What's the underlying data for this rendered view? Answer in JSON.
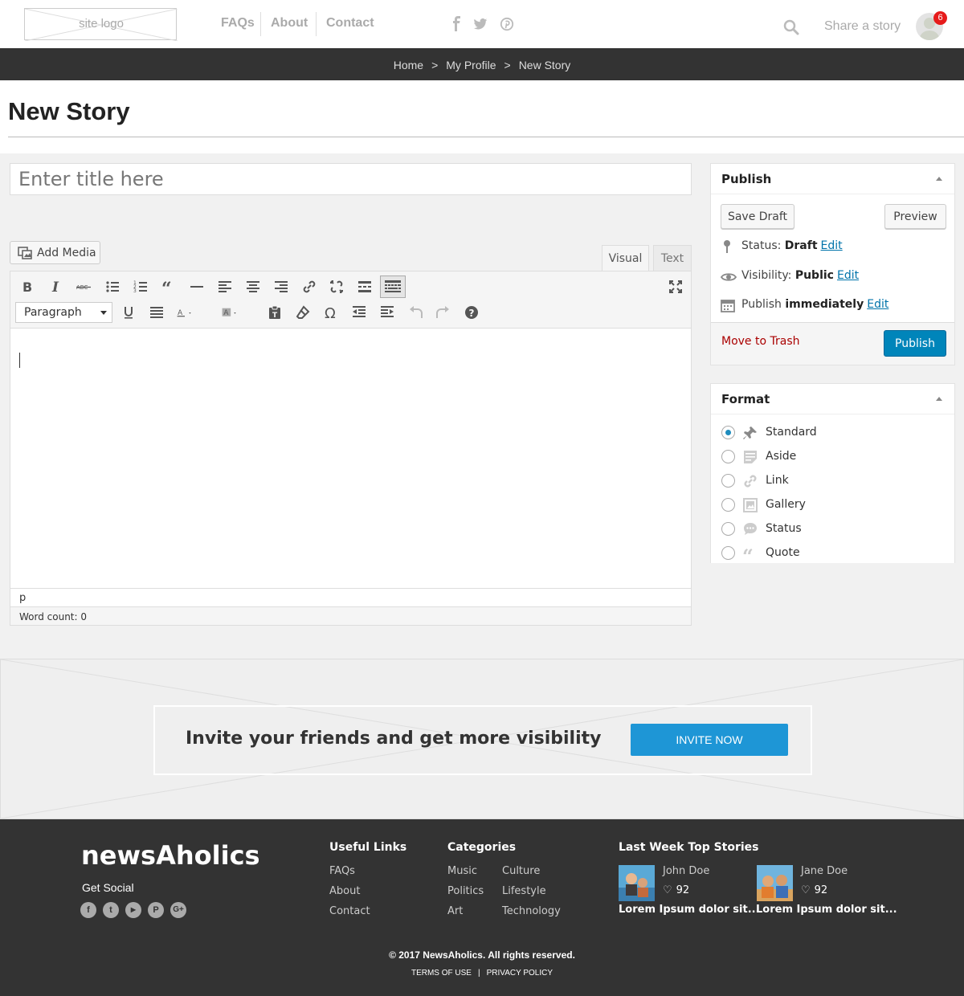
{
  "header": {
    "logo_text": "site logo",
    "nav": [
      "FAQs",
      "About",
      "Contact"
    ],
    "share_label": "Share a story",
    "notification_count": "6",
    "icons": [
      "facebook-icon",
      "twitter-icon",
      "pinterest-icon",
      "search-icon",
      "avatar"
    ]
  },
  "breadcrumb": {
    "items": [
      "Home",
      "My Profile",
      "New Story"
    ],
    "separator": ">"
  },
  "page": {
    "title": "New Story"
  },
  "editor": {
    "title_placeholder": "Enter title here",
    "add_media_label": "Add Media",
    "tabs": [
      "Visual",
      "Text"
    ],
    "active_tab": "Visual",
    "format_select": "Paragraph",
    "path": "p",
    "word_count": "Word count: 0",
    "toolbar_row1": [
      "bold",
      "italic",
      "strikethrough",
      "bulleted-list",
      "numbered-list",
      "blockquote",
      "horizontal-line",
      "align-left",
      "align-center",
      "align-right",
      "insert-link",
      "remove-link",
      "read-more",
      "toolbar-toggle",
      "fullscreen"
    ],
    "toolbar_row2": [
      "underline",
      "justify",
      "text-color",
      "background-color",
      "paste-as-text",
      "clear-formatting",
      "special-character",
      "decrease-indent",
      "increase-indent",
      "undo",
      "redo",
      "help"
    ]
  },
  "publish": {
    "title": "Publish",
    "save_draft": "Save Draft",
    "preview": "Preview",
    "status_label": "Status:",
    "status_value": "Draft",
    "visibility_label": "Visibility:",
    "visibility_value": "Public",
    "schedule_label": "Publish",
    "schedule_value": "immediately",
    "edit": "Edit",
    "move_to_trash": "Move to Trash",
    "publish_button": "Publish"
  },
  "format": {
    "title": "Format",
    "selected": "Standard",
    "options": [
      "Standard",
      "Aside",
      "Link",
      "Gallery",
      "Status",
      "Quote"
    ]
  },
  "invite": {
    "text": "Invite your friends and get more visibility",
    "button": "INVITE NOW"
  },
  "footer": {
    "brand": "newsAholics",
    "get_social": "Get Social",
    "social": [
      "f",
      "t",
      "▶",
      "P",
      "G+"
    ],
    "useful_links_title": "Useful Links",
    "useful_links": [
      "FAQs",
      "About",
      "Contact"
    ],
    "categories_title": "Categories",
    "categories_col1": [
      "Music",
      "Politics",
      "Art"
    ],
    "categories_col2": [
      "Culture",
      "Lifestyle",
      "Technology"
    ],
    "top_stories_title": "Last Week Top Stories",
    "top_stories": [
      {
        "author": "John Doe",
        "likes": "92",
        "snippet": "Lorem Ipsum dolor sit..."
      },
      {
        "author": "Jane Doe",
        "likes": "92",
        "snippet": "Lorem Ipsum dolor sit..."
      }
    ],
    "copyright": "© 2017 NewsAholics. All rights reserved.",
    "terms": "TERMS OF USE",
    "legal_sep": "|",
    "privacy": "PRIVACY POLICY"
  },
  "colors": {
    "accent": "#0085ba",
    "invite_button": "#1e96d6",
    "dark_bar": "#333333",
    "badge": "#e61b1b",
    "trash": "#aa0000"
  }
}
